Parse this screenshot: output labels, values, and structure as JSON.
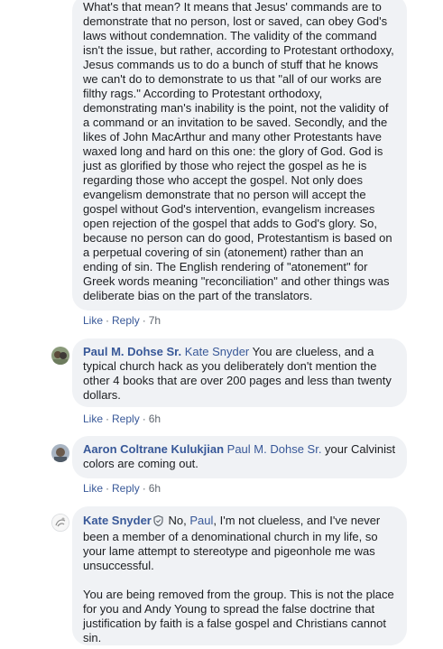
{
  "comments": [
    {
      "text": "What's that mean? It means that Jesus' commands are to demonstrate that no person, lost or saved, can obey God's laws without condemnation. The validity of the command isn't the issue, but rather, according to Protestant orthodoxy, Jesus commands us to do a bunch of stuff that he knows we can't do to demonstrate to us that \"all of our works are filthy rags.\" According to Protestant orthodoxy, demonstrating man's inability is the point, not the validity of a command or an invitation to be saved. Secondly, and the likes of John MacArthur and many other Protestants have waxed long and hard on this one: the glory of God. God is just as glorified by those who reject the gospel as he is regarding those who accept the gospel. Not only does evangelism demonstrate that no person will accept the gospel without God's intervention, evangelism increases open rejection of the gospel that adds to God's glory. So, because no person can do good, Protestantism is based on a perpetual covering of sin (atonement) rather than an ending of sin. The English rendering of \"atonement\" for Greek words meaning \"reconciliation\" and other things was deliberate bias on the part of the translators.",
      "like": "Like",
      "reply": "Reply",
      "time": "7h"
    },
    {
      "author": "Paul M. Dohse Sr.",
      "tag": "Kate Snyder",
      "text": " You are clueless, and a typical church hack as you deliberately don't mention the other 4 books that are over 200 pages and less than twenty dollars.",
      "like": "Like",
      "reply": "Reply",
      "time": "6h"
    },
    {
      "author": "Aaron Coltrane Kulukjian",
      "tag": "Paul M. Dohse Sr.",
      "text": " your Calvinist colors are coming out.",
      "like": "Like",
      "reply": "Reply",
      "time": "6h"
    },
    {
      "author": "Kate Snyder",
      "pre": " No, ",
      "tag": "Paul",
      "text": ", I'm not clueless, and I've never been a member of a denominational church in my life, so your lame attempt to stereotype and pigeonhole me was unsuccessful.",
      "text2": "You are being removed from the group. This is not the place for you and Andy Young to spread the false doctrine that justification by faith is a false gospel and Christians cannot sin."
    }
  ],
  "icons": {
    "admin_badge": "shield-icon"
  },
  "colors": {
    "link": "#385898",
    "bubble": "#f0f2f5",
    "meta": "#606770"
  }
}
